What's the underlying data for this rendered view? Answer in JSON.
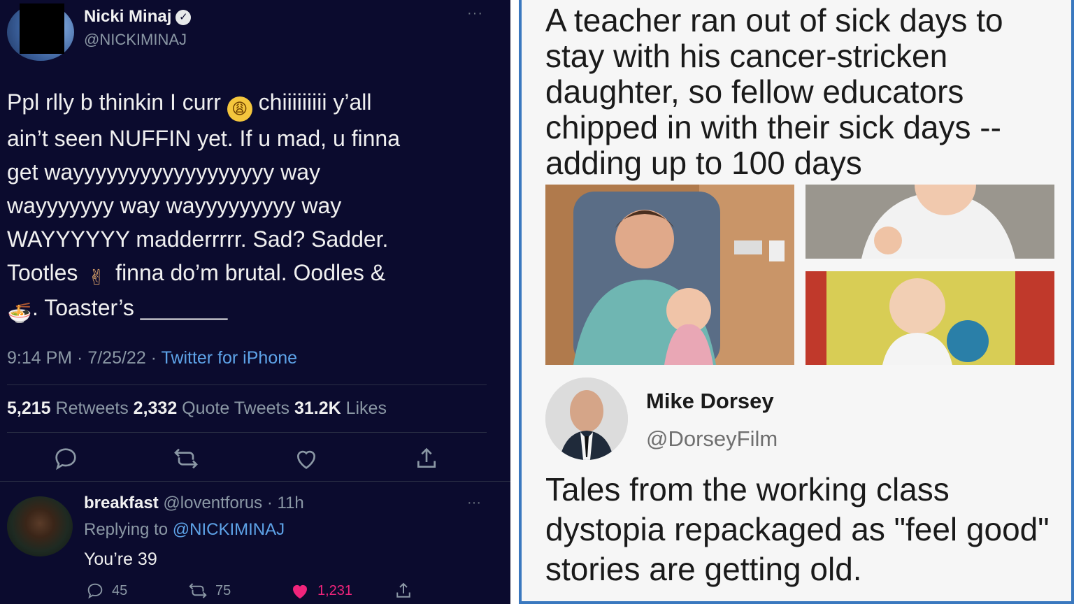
{
  "left_tweet": {
    "author": {
      "name": "Nicki Minaj",
      "handle": "@NICKIMINAJ"
    },
    "text_parts": {
      "p1": "Ppl rlly b thinkin I curr ",
      "p2": " chiiiiiiiii y’all\nain’t seen NUFFIN yet. If u mad, u finna\nget wayyyyyyyyyyyyyyyyyy way\nwayyyyyyy way wayyyyyyyyy way\nWAYYYYYY madderrrrr. Sad? Sadder.\nTootles ",
      "p3": " finna do’m brutal. Oodles &\n",
      "p4": ". Toaster’s _______"
    },
    "emoji_weary": "😩",
    "emoji_peace": "✌",
    "emoji_bowl": "🍜",
    "timestamp": "9:14 PM · 7/25/22 · ",
    "source": "Twitter for iPhone",
    "stats": {
      "retweets_count": "5,215",
      "retweets_label": " Retweets  ",
      "quotes_count": "2,332",
      "quotes_label": " Quote Tweets  ",
      "likes_count": "31.2K",
      "likes_label": " Likes"
    },
    "icons": [
      "reply-icon",
      "retweet-icon",
      "like-icon",
      "share-icon"
    ],
    "reply": {
      "name": "breakfast",
      "handle_time": " @loventforus · 11h",
      "replying_prefix": "Replying to ",
      "replying_to": "@NICKIMINAJ",
      "text": "You’re 39",
      "reply_count": "45",
      "retweet_count": "75",
      "like_count": "1,231"
    }
  },
  "right_meme": {
    "headline": "A teacher ran out of sick days to stay with his cancer-stricken daughter, so fellow educators chipped in with their sick days -- adding up to 100 days",
    "author": {
      "name": "Mike Dorsey",
      "handle": "@DorseyFilm"
    },
    "quote": "Tales from the working class dystopia repackaged as \"feel good\" stories are getting old."
  },
  "colors": {
    "dark_bg": "#0b0b2e",
    "link_blue": "#5ea3e8",
    "like_pink": "#f0247b",
    "border_blue": "#3a78bf"
  }
}
